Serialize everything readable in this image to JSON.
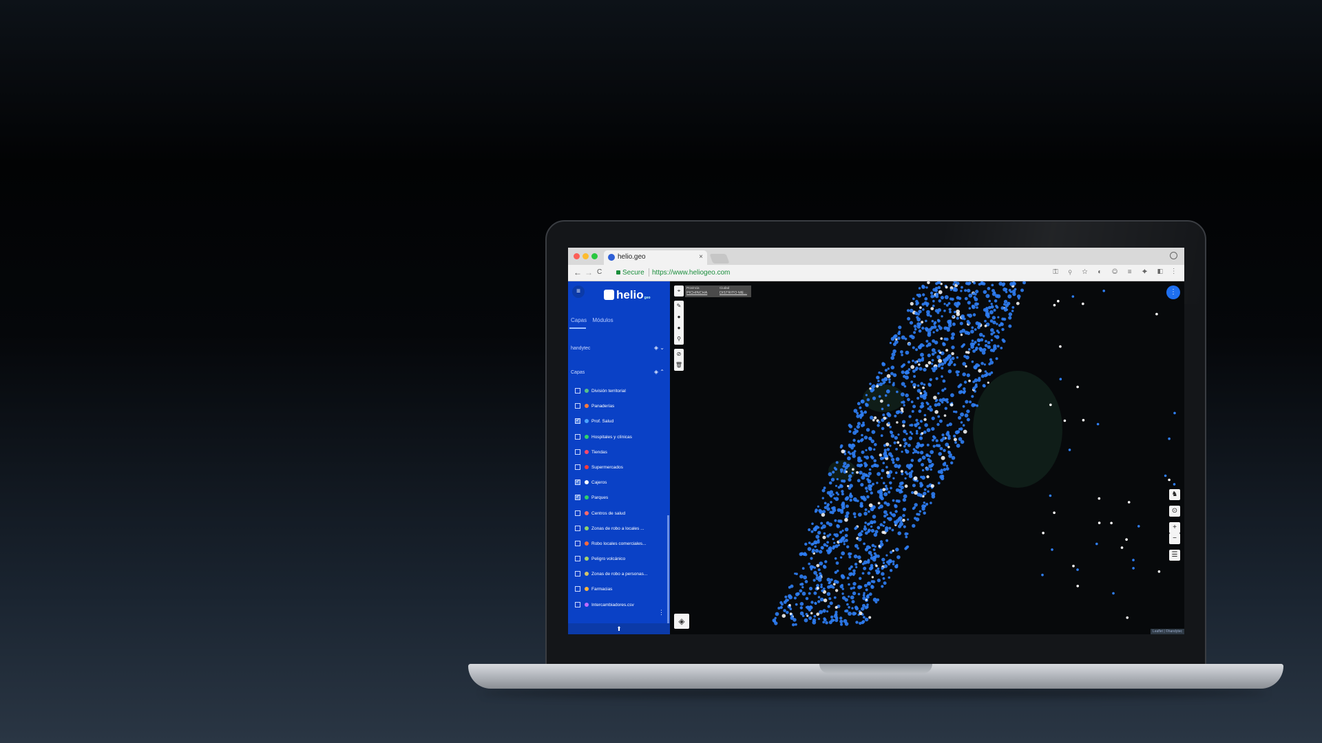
{
  "browser": {
    "tab_title": "helio.geo",
    "tab_close": "×",
    "secure_label": "Secure",
    "url": "https://www.heliogeo.com",
    "back": "←",
    "forward": "→",
    "reload": "C",
    "ext_icons": "⚿ ⚲ ☆ ◐ ◎ ≡ ✦ ◧ ⋮"
  },
  "app": {
    "logo_text": "helio",
    "logo_sub": "geo",
    "menu_icon": "≡",
    "tabs": [
      "Capas",
      "Módulos"
    ],
    "sections": [
      {
        "label": "handytec",
        "icons": "◈ ⌄"
      },
      {
        "label": "Capas",
        "icons": "◈ ⌃"
      }
    ],
    "layers": [
      {
        "label": "División territorial",
        "checked": false,
        "color": "#57c08a"
      },
      {
        "label": "Panaderías",
        "checked": false,
        "color": "#ff7a3c"
      },
      {
        "label": "Prof. Salud",
        "checked": true,
        "color": "#4aa3ff"
      },
      {
        "label": "Hospitales y clínicas",
        "checked": false,
        "color": "#2fd36b"
      },
      {
        "label": "Tiendas",
        "checked": false,
        "color": "#ff4a6a"
      },
      {
        "label": "Supermercados",
        "checked": false,
        "color": "#ff3b3b"
      },
      {
        "label": "Cajeros",
        "checked": true,
        "color": "#ffffff"
      },
      {
        "label": "Parques",
        "checked": true,
        "color": "#2fcf6b"
      },
      {
        "label": "Centros de salud",
        "checked": false,
        "color": "#ff6a6a"
      },
      {
        "label": "Zonas de robo a locales ...",
        "checked": false,
        "color": "#8fd36b"
      },
      {
        "label": "Robo locales comerciales...",
        "checked": false,
        "color": "#ff6a3c"
      },
      {
        "label": "Peligro volcánico",
        "checked": false,
        "color": "#a6d36b"
      },
      {
        "label": "Zonas de robo a personas...",
        "checked": false,
        "color": "#d3c36b"
      },
      {
        "label": "Farmacias",
        "checked": false,
        "color": "#ffb43c"
      },
      {
        "label": "Intercambiadores.csv",
        "checked": false,
        "color": "#c06bff"
      }
    ],
    "upload_icon": "⬆",
    "kebab_icon": "⋮"
  },
  "map": {
    "filter": {
      "label1": "Provincia",
      "value1": "PICHINCHA",
      "label2": "Ciudad",
      "value2": "DISTRITO ME..."
    },
    "tools_top": [
      "⌖",
      "✎",
      "●",
      "●",
      "⚲"
    ],
    "tools_bottom": [
      "⊘",
      "🗑"
    ],
    "fab_icon": "⋮",
    "controls": [
      "♞",
      "⊙",
      "+",
      "−",
      "☰"
    ],
    "layers_icon": "◈",
    "attribution": "Leaflet | ©handytec"
  }
}
